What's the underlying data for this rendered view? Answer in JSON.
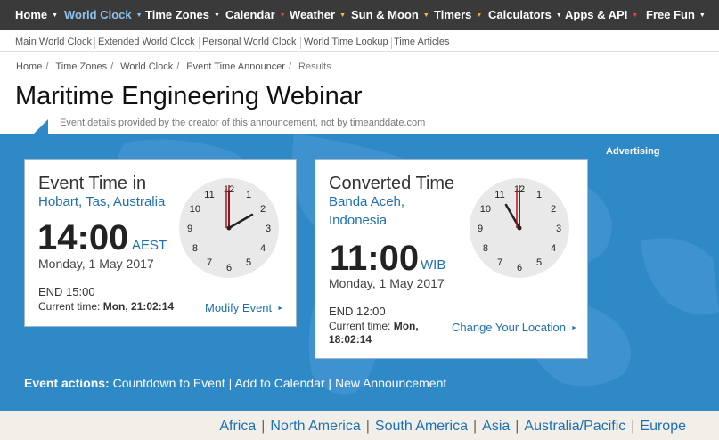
{
  "topnav": {
    "items": [
      {
        "label": "Home",
        "active": false
      },
      {
        "label": "World Clock",
        "active": true
      },
      {
        "label": "Time Zones",
        "active": false
      },
      {
        "label": "Calendar",
        "active": false
      },
      {
        "label": "Weather",
        "active": false
      },
      {
        "label": "Sun & Moon",
        "active": false
      },
      {
        "label": "Timers",
        "active": false
      },
      {
        "label": "Calculators",
        "active": false
      },
      {
        "label": "Apps & API",
        "active": false
      },
      {
        "label": "Free Fun",
        "active": false
      }
    ],
    "caret": "▼",
    "caret_colors": [
      "#ffffff",
      "#8ec1ef",
      "#ffffff",
      "#e04a3f",
      "#eac24a",
      "#eac24a",
      "#e3a93a",
      "#ffffff",
      "#e04a3f",
      "#ffffff"
    ]
  },
  "subnav": {
    "items": [
      "Main World Clock",
      "Extended World Clock",
      "Personal World Clock",
      "World Time Lookup",
      "Time Articles"
    ]
  },
  "breadcrumb": {
    "items": [
      "Home",
      "Time Zones",
      "World Clock",
      "Event Time Announcer",
      "Results"
    ],
    "separator": "/"
  },
  "page": {
    "title": "Maritime Engineering Webinar",
    "subtitle": "Event details provided by the creator of this announcement, not by timeanddate.com"
  },
  "advertising": "Advertising",
  "event_card": {
    "heading": "Event Time in",
    "location": "Hobart, Tas, Australia",
    "time": "14:00",
    "tz": "AEST",
    "date": "Monday, 1 May 2017",
    "end": "END 15:00",
    "current_label": "Current time:",
    "current_value": "Mon, 21:02:14",
    "link": "Modify Event",
    "link_arrow": "►",
    "clock": {
      "hour": 2,
      "minute": 0,
      "second": 0
    }
  },
  "converted_card": {
    "heading": "Converted Time",
    "location_line1": "Banda Aceh,",
    "location_line2": "Indonesia",
    "time": "11:00",
    "tz": "WIB",
    "date": "Monday, 1 May 2017",
    "end": "END 12:00",
    "current_label": "Current time:",
    "current_value_line1": "Mon,",
    "current_value_line2": "18:02:14",
    "link": "Change Your Location",
    "link_arrow": "►",
    "clock": {
      "hour": 11,
      "minute": 0,
      "second": 0
    }
  },
  "clock_numbers": [
    "12",
    "1",
    "2",
    "3",
    "4",
    "5",
    "6",
    "7",
    "8",
    "9",
    "10",
    "11"
  ],
  "actions": {
    "label": "Event actions:",
    "items": [
      "Countdown to Event",
      "Add to Calendar",
      "New Announcement"
    ],
    "separator": "|"
  },
  "regions": {
    "items": [
      "Africa",
      "North America",
      "South America",
      "Asia",
      "Australia/Pacific",
      "Europe"
    ],
    "separator": "|"
  },
  "colors": {
    "nav_bg": "#3a3a3a",
    "nav_active": "#8ec1ef",
    "blue_panel": "#3089c7",
    "link_blue": "#1d6fb3",
    "second_hand": "#b0131e"
  }
}
